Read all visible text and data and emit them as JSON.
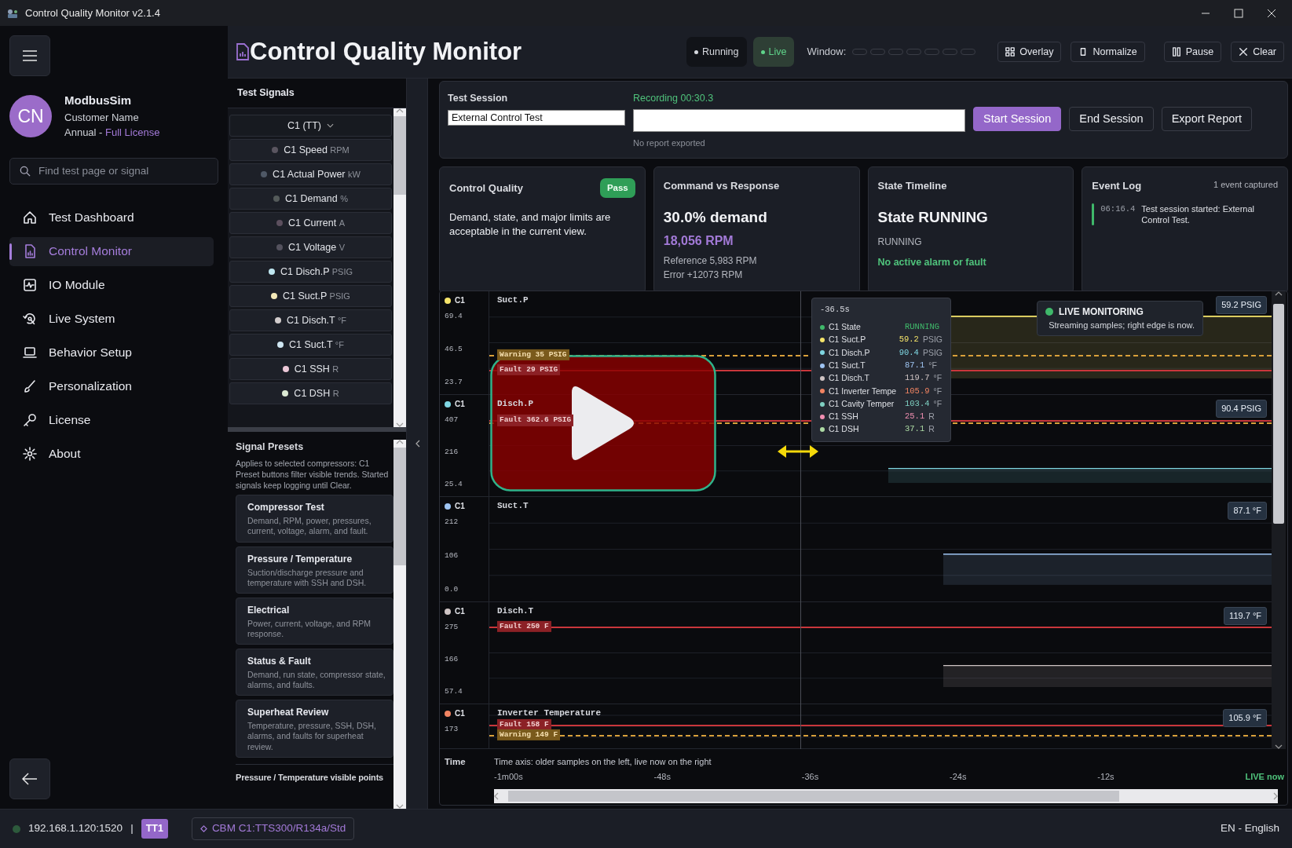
{
  "window": {
    "title": "Control Quality Monitor v2.1.4"
  },
  "sidebar": {
    "user": {
      "initials": "CN",
      "name": "ModbusSim",
      "customer": "Customer Name",
      "plan": "Annual - ",
      "license": "Full License"
    },
    "search": {
      "placeholder": "Find test page or signal"
    },
    "items": [
      {
        "label": "Test Dashboard",
        "selected": false
      },
      {
        "label": "Control Monitor",
        "selected": true
      },
      {
        "label": "IO Module",
        "selected": false
      },
      {
        "label": "Live System",
        "selected": false
      },
      {
        "label": "Behavior Setup",
        "selected": false
      },
      {
        "label": "Personalization",
        "selected": false
      },
      {
        "label": "License",
        "selected": false
      },
      {
        "label": "About",
        "selected": false
      }
    ]
  },
  "header": {
    "title": "Control Quality Monitor",
    "status": [
      {
        "label": "Running",
        "kind": "running"
      },
      {
        "label": "Live",
        "kind": "live"
      }
    ],
    "window_label": "Window:",
    "window_segments": [
      {
        "selected": false
      },
      {
        "selected": false
      },
      {
        "selected": false
      },
      {
        "selected": false
      },
      {
        "selected": false
      },
      {
        "selected": false
      },
      {
        "selected": false
      }
    ],
    "tools": [
      "Overlay",
      "Normalize",
      "Pause",
      "Clear"
    ]
  },
  "signals": {
    "title": "Test Signals",
    "group": "C1 (TT)",
    "items": [
      {
        "name": "C1 Speed",
        "unit": "RPM",
        "color": "#5a5560"
      },
      {
        "name": "C1 Actual Power",
        "unit": "kW",
        "color": "#4f5866"
      },
      {
        "name": "C1 Demand",
        "unit": "%",
        "color": "#545a5a"
      },
      {
        "name": "C1 Current",
        "unit": "A",
        "color": "#5c4f5e"
      },
      {
        "name": "C1 Voltage",
        "unit": "V",
        "color": "#54525e"
      },
      {
        "name": "C1 Disch.P",
        "unit": "PSIG",
        "color": "#bfe6f0"
      },
      {
        "name": "C1 Suct.P",
        "unit": "PSIG",
        "color": "#f3e8b8"
      },
      {
        "name": "C1 Disch.T",
        "unit": "°F",
        "color": "#d2cccc"
      },
      {
        "name": "C1 Suct.T",
        "unit": "°F",
        "color": "#cfe6f2"
      },
      {
        "name": "C1 SSH",
        "unit": "R",
        "color": "#ecc8d8"
      },
      {
        "name": "C1 DSH",
        "unit": "R",
        "color": "#dbe8d3"
      }
    ]
  },
  "presets": {
    "title": "Signal Presets",
    "notes": [
      "Applies to selected compressors: C1",
      "Preset buttons filter visible trends. Started signals keep logging until Clear."
    ],
    "items": [
      {
        "title": "Compressor Test",
        "description": "Demand, RPM, power, pressures, current, voltage, alarm, and fault."
      },
      {
        "title": "Pressure / Temperature",
        "description": "Suction/discharge pressure and temperature with SSH and DSH."
      },
      {
        "title": "Electrical",
        "description": "Power, current, voltage, and RPM response."
      },
      {
        "title": "Status & Fault",
        "description": "Demand, run state, compressor state, alarms, and faults."
      },
      {
        "title": "Superheat Review",
        "description": "Temperature, pressure, SSH, DSH, alarms, and faults for superheat review."
      }
    ],
    "footer": "Pressure / Temperature visible points"
  },
  "session": {
    "label": "Test Session",
    "name": "External Control Test",
    "recording": "Recording 00:30.3",
    "report_status": "No report exported",
    "buttons": [
      {
        "label": "Start Session",
        "kind": "primary"
      },
      {
        "label": "End Session",
        "kind": "outline"
      },
      {
        "label": "Export Report",
        "kind": "outline"
      }
    ]
  },
  "cards": {
    "quality": {
      "title": "Control Quality",
      "badge": "Pass",
      "text": "Demand, state, and major limits are acceptable in the current view."
    },
    "command": {
      "title": "Command vs Response",
      "demand": "30.0% demand",
      "rpm": "18,056 RPM",
      "reference": "Reference 5,983 RPM",
      "error": "Error +12073 RPM"
    },
    "state": {
      "title": "State Timeline",
      "state": "State RUNNING",
      "sub": "RUNNING",
      "alarm": "No active alarm or fault"
    },
    "events": {
      "title": "Event Log",
      "count": "1 event captured",
      "entries": [
        {
          "time": "06:16.4",
          "text": "Test session started: External Control Test."
        }
      ]
    }
  },
  "chart": {
    "panels": [
      {
        "signal": "C1",
        "color": "#f5e46a",
        "title": "Suct.P",
        "ticks": [
          "69.4",
          "46.5",
          "23.7"
        ],
        "badge": "59.2 PSIG",
        "limits": [
          {
            "kind": "warning",
            "label": "Warning 35 PSIG"
          },
          {
            "kind": "fault",
            "label": "Fault 29 PSIG"
          }
        ]
      },
      {
        "signal": "C1",
        "color": "#7fd6e2",
        "title": "Disch.P",
        "ticks": [
          "407",
          "216",
          "25.4"
        ],
        "badge": "90.4 PSIG",
        "limits": [
          {
            "kind": "fault",
            "label": "Fault 362.6 PSIG"
          },
          {
            "kind": "warning"
          }
        ]
      },
      {
        "signal": "C1",
        "color": "#9ec4f2",
        "title": "Suct.T",
        "ticks": [
          "212",
          "106",
          "0.0"
        ],
        "badge": "87.1 °F"
      },
      {
        "signal": "C1",
        "color": "#cfc4c4",
        "title": "Disch.T",
        "ticks": [
          "275",
          "166",
          "57.4"
        ],
        "badge": "119.7 °F",
        "limits": [
          {
            "kind": "fault",
            "label": "Fault 250 F"
          }
        ]
      },
      {
        "signal": "C1",
        "color": "#f28462",
        "title": "Inverter Temperature",
        "ticks": [
          "173"
        ],
        "badge": "105.9 °F",
        "limits": [
          {
            "kind": "fault",
            "label": "Fault 158 F"
          },
          {
            "kind": "warning",
            "label": "Warning 149 F"
          }
        ]
      }
    ],
    "tooltip": {
      "time": "-36.5s",
      "rows": [
        {
          "name": "C1 State",
          "value": "RUNNING",
          "color": "#3fb86a"
        },
        {
          "name": "C1 Suct.P",
          "value": "59.2",
          "unit": "PSIG",
          "color": "#f5e46a"
        },
        {
          "name": "C1 Disch.P",
          "value": "90.4",
          "unit": "PSIG",
          "color": "#7fd6e2"
        },
        {
          "name": "C1 Suct.T",
          "value": "87.1",
          "unit": "°F",
          "color": "#9ec4f2"
        },
        {
          "name": "C1 Disch.T",
          "value": "119.7",
          "unit": "°F",
          "color": "#cfc4c4"
        },
        {
          "name": "C1 Inverter Tempe",
          "value": "105.9",
          "unit": "°F",
          "color": "#f28462"
        },
        {
          "name": "C1 Cavity Temper",
          "value": "103.4",
          "unit": "°F",
          "color": "#7fd0c2"
        },
        {
          "name": "C1 SSH",
          "value": "25.1",
          "unit": "R",
          "color": "#f28fb2"
        },
        {
          "name": "C1 DSH",
          "value": "37.1",
          "unit": "R",
          "color": "#addba4"
        }
      ]
    },
    "live": {
      "title": "LIVE MONITORING",
      "text": "Streaming samples; right edge is now."
    },
    "time": {
      "label": "Time",
      "caption": "Time axis: older samples on the left, live now on the right",
      "ticks": [
        "-1m00s",
        "-48s",
        "-36s",
        "-24s",
        "-12s"
      ],
      "live": "LIVE now"
    }
  },
  "status_bar": {
    "address": "192.168.1.120:1520",
    "separator": "|",
    "tag": "TT1",
    "model": "CBM C1:TTS300/R134a/Std",
    "language": "EN - English"
  }
}
